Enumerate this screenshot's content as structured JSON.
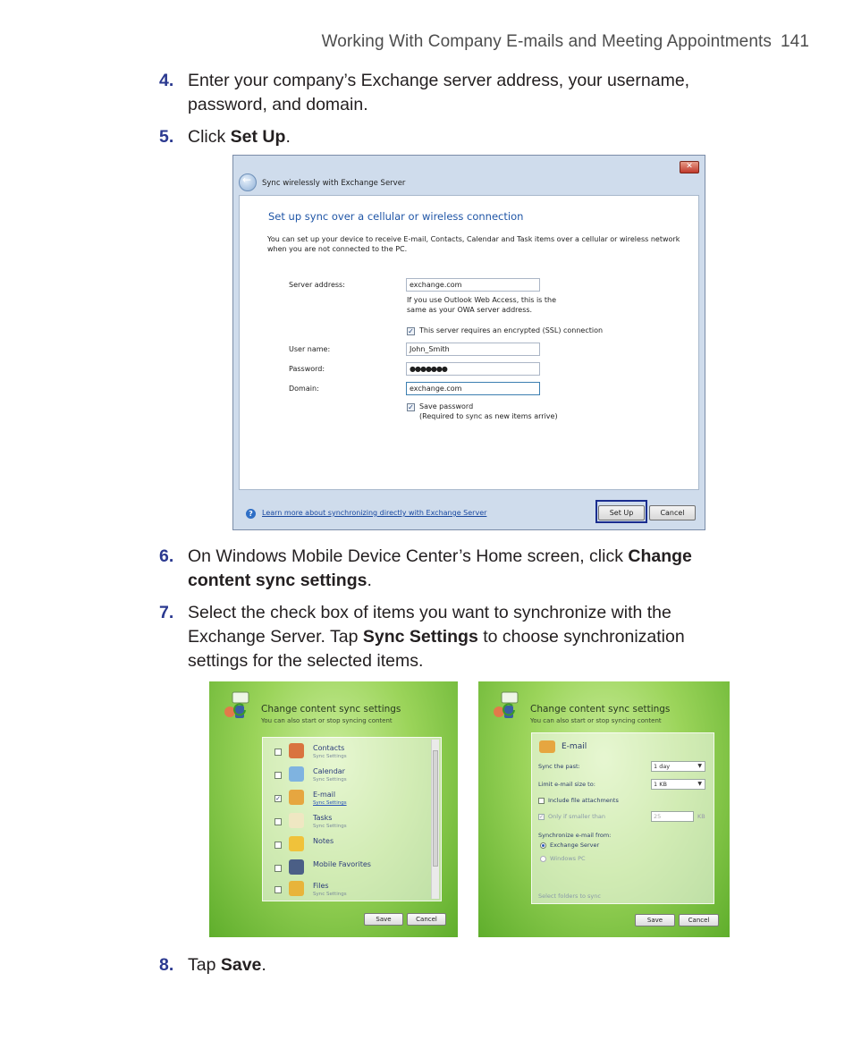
{
  "header": {
    "title": "Working With Company E-mails and Meeting Appointments",
    "page_number": "141"
  },
  "steps": [
    {
      "num": "4.",
      "text": "Enter your company’s Exchange server address, your username, password, and domain."
    },
    {
      "num": "5.",
      "pre": "Click ",
      "bold": "Set Up",
      "post": "."
    },
    {
      "num": "6.",
      "pre": "On Windows Mobile Device Center’s Home screen, click ",
      "bold": "Change content sync settings",
      "post": "."
    },
    {
      "num": "7.",
      "pre": "Select the check box of items you want to synchronize with the Exchange Server. Tap ",
      "bold": "Sync Settings",
      "post": " to choose synchronization settings for the selected items."
    },
    {
      "num": "8.",
      "pre": "Tap ",
      "bold": "Save",
      "post": "."
    }
  ],
  "dialog1": {
    "title": "Sync wirelessly with Exchange Server",
    "close": "✕",
    "heading": "Set up sync over a cellular or wireless connection",
    "intro": "You can set up your device to receive E-mail, Contacts, Calendar and Task items over a cellular or wireless network when you are not connected to the PC.",
    "server_label": "Server address:",
    "server_value": "exchange.com",
    "server_hint": "If you use Outlook Web Access, this is the same as your OWA server address.",
    "ssl_label": "This server requires an encrypted (SSL) connection",
    "ssl_checked": "✓",
    "user_label": "User name:",
    "user_value": "John_Smith",
    "password_label": "Password:",
    "password_value": "●●●●●●●",
    "domain_label": "Domain:",
    "domain_value": "exchange.com",
    "save_pw_label": "Save password",
    "save_pw_note": "(Required to sync as new items arrive)",
    "save_pw_checked": "✓",
    "help_icon": "?",
    "learn_more": "Learn more about synchronizing directly with Exchange Server",
    "setup_button": "Set Up",
    "cancel_button": "Cancel"
  },
  "panel_left": {
    "title": "Change content sync settings",
    "subtitle": "You can also start or stop syncing content",
    "items": [
      {
        "name": "Contacts",
        "sub": "Sync Settings",
        "checked": ""
      },
      {
        "name": "Calendar",
        "sub": "Sync Settings",
        "checked": ""
      },
      {
        "name": "E-mail",
        "sub": "Sync Settings",
        "checked": "✓"
      },
      {
        "name": "Tasks",
        "sub": "Sync Settings",
        "checked": ""
      },
      {
        "name": "Notes",
        "sub": "",
        "checked": ""
      },
      {
        "name": "Mobile Favorites",
        "sub": "",
        "checked": ""
      },
      {
        "name": "Files",
        "sub": "Sync Settings",
        "checked": ""
      }
    ],
    "save_button": "Save",
    "cancel_button": "Cancel"
  },
  "panel_right": {
    "title": "Change content sync settings",
    "subtitle": "You can also start or stop syncing content",
    "section_title": "E-mail",
    "sync_past_label": "Sync the past:",
    "sync_past_value": "1 day",
    "limit_label": "Limit e-mail size to:",
    "limit_value": "1 KB",
    "attachments_label": "Include file attachments",
    "smaller_label": "Only if smaller than",
    "smaller_value": "25",
    "smaller_unit": "KB",
    "sync_from_label": "Synchronize e-mail from:",
    "radio_exchange": "Exchange Server",
    "radio_pc": "Windows PC",
    "select_folders": "Select folders to sync",
    "save_button": "Save",
    "cancel_button": "Cancel",
    "dropdown_arrow": "▼",
    "checked_mark": "✓"
  },
  "colors": {
    "step_number": "#2b3990",
    "heading_blue": "#1f55a6",
    "green_panel": "#9bd45a"
  }
}
